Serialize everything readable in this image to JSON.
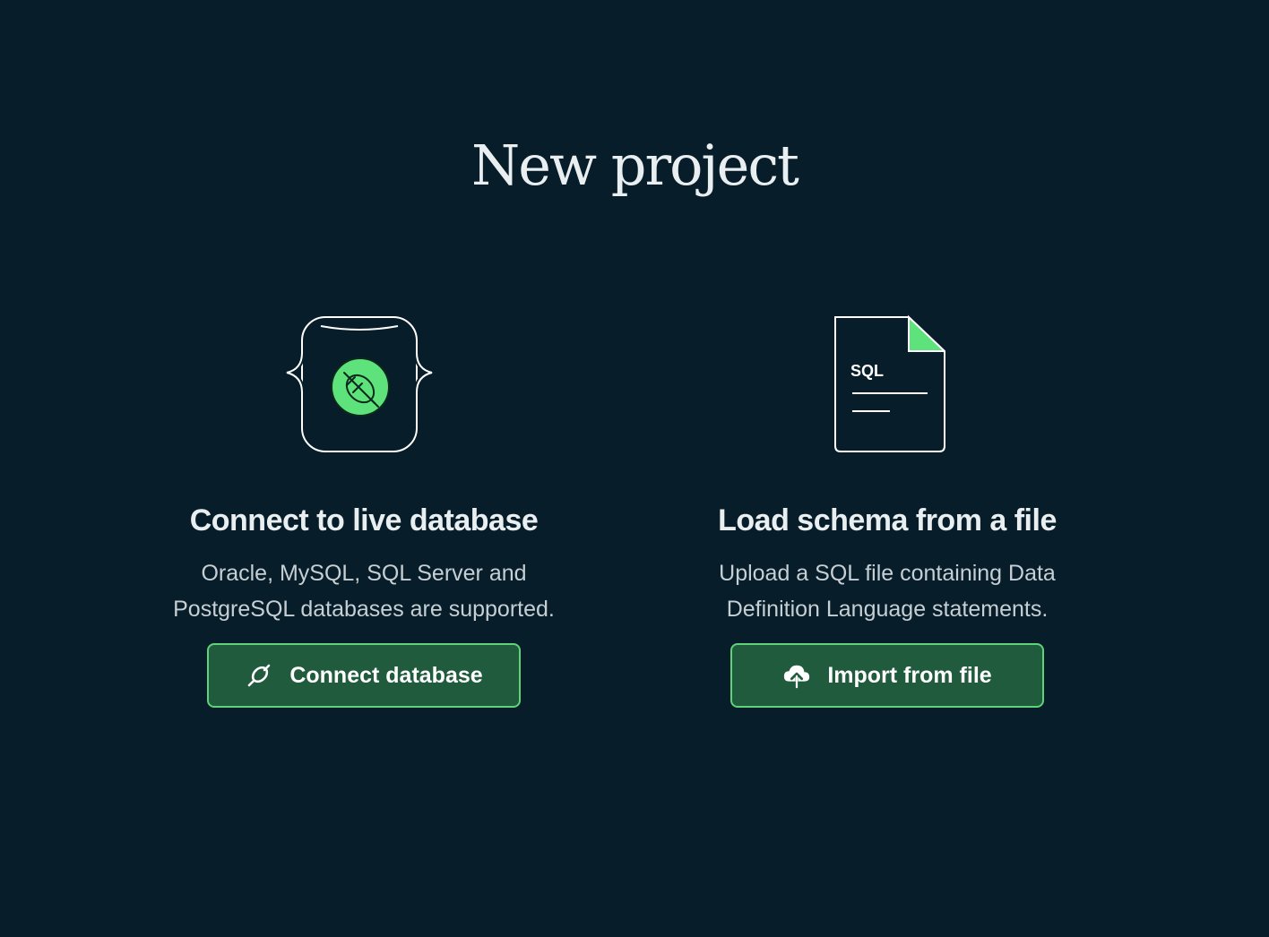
{
  "page": {
    "title": "New project"
  },
  "options": [
    {
      "title": "Connect to live database",
      "description_line1": "Oracle, MySQL, SQL Server and",
      "description_line2": "PostgreSQL databases are supported.",
      "button_label": "Connect database",
      "button_icon": "plug-icon",
      "illustration": "database-plug-illustration"
    },
    {
      "title": "Load schema from a file",
      "description_line1": "Upload a SQL file containing Data",
      "description_line2": "Definition Language statements.",
      "button_label": "Import from file",
      "button_icon": "cloud-upload-icon",
      "illustration": "sql-file-illustration",
      "file_label": "SQL"
    }
  ],
  "colors": {
    "background": "#071d29",
    "accent": "#5fd37a",
    "button_fill": "#1f5b3c",
    "text": "#e9eef0"
  }
}
